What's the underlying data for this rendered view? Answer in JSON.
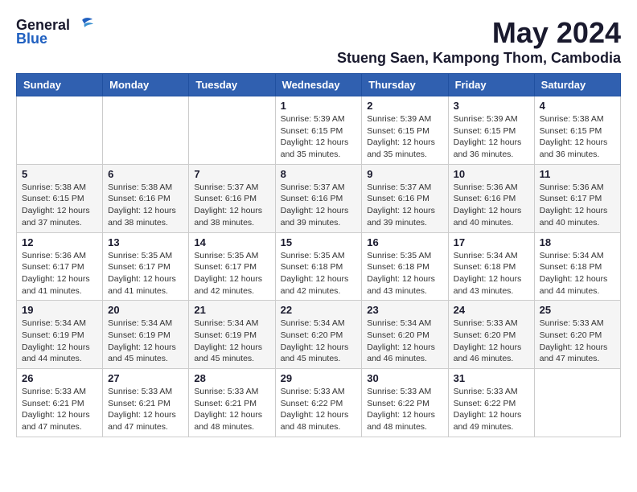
{
  "header": {
    "logo_general": "General",
    "logo_blue": "Blue",
    "month_title": "May 2024",
    "location": "Stueng Saen, Kampong Thom, Cambodia"
  },
  "weekdays": [
    "Sunday",
    "Monday",
    "Tuesday",
    "Wednesday",
    "Thursday",
    "Friday",
    "Saturday"
  ],
  "weeks": [
    [
      {
        "day": "",
        "info": ""
      },
      {
        "day": "",
        "info": ""
      },
      {
        "day": "",
        "info": ""
      },
      {
        "day": "1",
        "info": "Sunrise: 5:39 AM\nSunset: 6:15 PM\nDaylight: 12 hours\nand 35 minutes."
      },
      {
        "day": "2",
        "info": "Sunrise: 5:39 AM\nSunset: 6:15 PM\nDaylight: 12 hours\nand 35 minutes."
      },
      {
        "day": "3",
        "info": "Sunrise: 5:39 AM\nSunset: 6:15 PM\nDaylight: 12 hours\nand 36 minutes."
      },
      {
        "day": "4",
        "info": "Sunrise: 5:38 AM\nSunset: 6:15 PM\nDaylight: 12 hours\nand 36 minutes."
      }
    ],
    [
      {
        "day": "5",
        "info": "Sunrise: 5:38 AM\nSunset: 6:15 PM\nDaylight: 12 hours\nand 37 minutes."
      },
      {
        "day": "6",
        "info": "Sunrise: 5:38 AM\nSunset: 6:16 PM\nDaylight: 12 hours\nand 38 minutes."
      },
      {
        "day": "7",
        "info": "Sunrise: 5:37 AM\nSunset: 6:16 PM\nDaylight: 12 hours\nand 38 minutes."
      },
      {
        "day": "8",
        "info": "Sunrise: 5:37 AM\nSunset: 6:16 PM\nDaylight: 12 hours\nand 39 minutes."
      },
      {
        "day": "9",
        "info": "Sunrise: 5:37 AM\nSunset: 6:16 PM\nDaylight: 12 hours\nand 39 minutes."
      },
      {
        "day": "10",
        "info": "Sunrise: 5:36 AM\nSunset: 6:16 PM\nDaylight: 12 hours\nand 40 minutes."
      },
      {
        "day": "11",
        "info": "Sunrise: 5:36 AM\nSunset: 6:17 PM\nDaylight: 12 hours\nand 40 minutes."
      }
    ],
    [
      {
        "day": "12",
        "info": "Sunrise: 5:36 AM\nSunset: 6:17 PM\nDaylight: 12 hours\nand 41 minutes."
      },
      {
        "day": "13",
        "info": "Sunrise: 5:35 AM\nSunset: 6:17 PM\nDaylight: 12 hours\nand 41 minutes."
      },
      {
        "day": "14",
        "info": "Sunrise: 5:35 AM\nSunset: 6:17 PM\nDaylight: 12 hours\nand 42 minutes."
      },
      {
        "day": "15",
        "info": "Sunrise: 5:35 AM\nSunset: 6:18 PM\nDaylight: 12 hours\nand 42 minutes."
      },
      {
        "day": "16",
        "info": "Sunrise: 5:35 AM\nSunset: 6:18 PM\nDaylight: 12 hours\nand 43 minutes."
      },
      {
        "day": "17",
        "info": "Sunrise: 5:34 AM\nSunset: 6:18 PM\nDaylight: 12 hours\nand 43 minutes."
      },
      {
        "day": "18",
        "info": "Sunrise: 5:34 AM\nSunset: 6:18 PM\nDaylight: 12 hours\nand 44 minutes."
      }
    ],
    [
      {
        "day": "19",
        "info": "Sunrise: 5:34 AM\nSunset: 6:19 PM\nDaylight: 12 hours\nand 44 minutes."
      },
      {
        "day": "20",
        "info": "Sunrise: 5:34 AM\nSunset: 6:19 PM\nDaylight: 12 hours\nand 45 minutes."
      },
      {
        "day": "21",
        "info": "Sunrise: 5:34 AM\nSunset: 6:19 PM\nDaylight: 12 hours\nand 45 minutes."
      },
      {
        "day": "22",
        "info": "Sunrise: 5:34 AM\nSunset: 6:20 PM\nDaylight: 12 hours\nand 45 minutes."
      },
      {
        "day": "23",
        "info": "Sunrise: 5:34 AM\nSunset: 6:20 PM\nDaylight: 12 hours\nand 46 minutes."
      },
      {
        "day": "24",
        "info": "Sunrise: 5:33 AM\nSunset: 6:20 PM\nDaylight: 12 hours\nand 46 minutes."
      },
      {
        "day": "25",
        "info": "Sunrise: 5:33 AM\nSunset: 6:20 PM\nDaylight: 12 hours\nand 47 minutes."
      }
    ],
    [
      {
        "day": "26",
        "info": "Sunrise: 5:33 AM\nSunset: 6:21 PM\nDaylight: 12 hours\nand 47 minutes."
      },
      {
        "day": "27",
        "info": "Sunrise: 5:33 AM\nSunset: 6:21 PM\nDaylight: 12 hours\nand 47 minutes."
      },
      {
        "day": "28",
        "info": "Sunrise: 5:33 AM\nSunset: 6:21 PM\nDaylight: 12 hours\nand 48 minutes."
      },
      {
        "day": "29",
        "info": "Sunrise: 5:33 AM\nSunset: 6:22 PM\nDaylight: 12 hours\nand 48 minutes."
      },
      {
        "day": "30",
        "info": "Sunrise: 5:33 AM\nSunset: 6:22 PM\nDaylight: 12 hours\nand 48 minutes."
      },
      {
        "day": "31",
        "info": "Sunrise: 5:33 AM\nSunset: 6:22 PM\nDaylight: 12 hours\nand 49 minutes."
      },
      {
        "day": "",
        "info": ""
      }
    ]
  ]
}
